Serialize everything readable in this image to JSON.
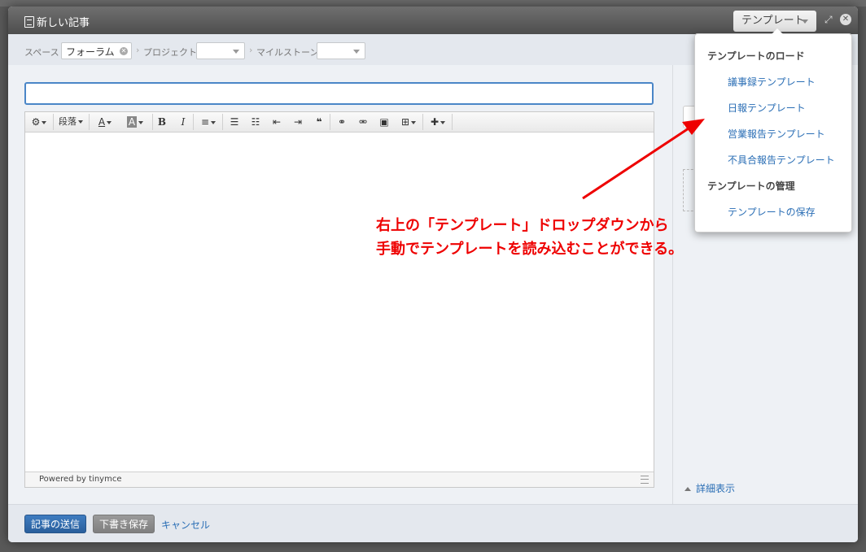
{
  "modal": {
    "title": "新しい記事",
    "template_button": "テンプレート"
  },
  "filters": {
    "space_label": "スペース",
    "space_value": "フォーラム",
    "project_label": "プロジェクト",
    "milestone_label": "マイルストーン"
  },
  "editor": {
    "toolbar": {
      "paragraph": "段落",
      "bold": "B",
      "italic": "I"
    },
    "status": "Powered by tinymce"
  },
  "side": {
    "detail_link": "詳細表示"
  },
  "footer": {
    "submit": "記事の送信",
    "save_draft": "下書き保存",
    "cancel": "キャンセル"
  },
  "dropdown": {
    "load_heading": "テンプレートのロード",
    "items": [
      "議事録テンプレート",
      "日報テンプレート",
      "営業報告テンプレート",
      "不具合報告テンプレート"
    ],
    "manage_heading": "テンプレートの管理",
    "manage_items": [
      "テンプレートの保存"
    ]
  },
  "callout": {
    "line1": "右上の「テンプレート」ドロップダウンから",
    "line2": "手動でテンプレートを読み込むことができる。"
  },
  "colors": {
    "accent": "#2a6eb5",
    "annotation": "#e00000"
  }
}
